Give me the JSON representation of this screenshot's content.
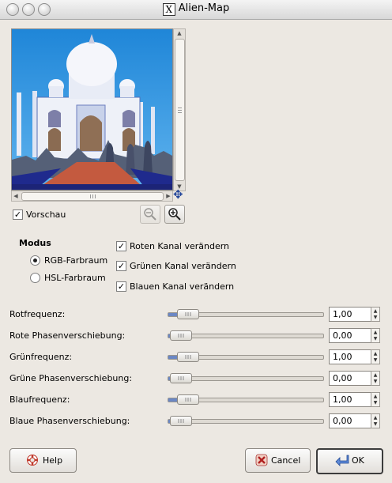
{
  "window": {
    "title": "Alien-Map",
    "app_icon": "X"
  },
  "preview": {
    "checkbox_label": "Vorschau",
    "checked": true
  },
  "mode": {
    "heading": "Modus",
    "options": [
      {
        "label": "RGB-Farbraum",
        "selected": true
      },
      {
        "label": "HSL-Farbraum",
        "selected": false
      }
    ]
  },
  "channels": [
    {
      "label": "Roten Kanal verändern",
      "checked": true
    },
    {
      "label": "Grünen Kanal verändern",
      "checked": true
    },
    {
      "label": "Blauen Kanal verändern",
      "checked": true
    }
  ],
  "sliders": [
    {
      "label": "Rotfrequenz:",
      "value": "1,00",
      "fraction": 0.05
    },
    {
      "label": "Rote Phasenverschiebung:",
      "value": "0,00",
      "fraction": 0.0
    },
    {
      "label": "Grünfrequenz:",
      "value": "1,00",
      "fraction": 0.05
    },
    {
      "label": "Grüne Phasenverschiebung:",
      "value": "0,00",
      "fraction": 0.0
    },
    {
      "label": "Blaufrequenz:",
      "value": "1,00",
      "fraction": 0.05
    },
    {
      "label": "Blaue Phasenverschiebung:",
      "value": "0,00",
      "fraction": 0.0
    }
  ],
  "buttons": {
    "help": "Help",
    "cancel": "Cancel",
    "ok": "OK"
  },
  "icons": {
    "zoom_out": "zoom-out-icon",
    "zoom_in": "zoom-in-icon",
    "navigate": "navigate-icon",
    "help": "lifebuoy-icon",
    "cancel": "cancel-x-icon",
    "ok": "ok-arrow-icon"
  }
}
